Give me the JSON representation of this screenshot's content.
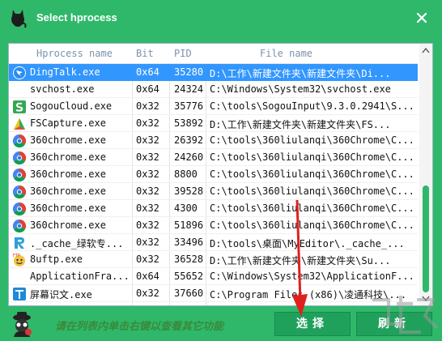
{
  "window": {
    "title": "Select hprocess",
    "app_icon": "black-cat-icon",
    "close_icon": "close-icon",
    "accent_color": "#2fb86a",
    "selection_color": "#3296ff"
  },
  "table": {
    "columns": [
      "Hprocess name",
      "Bit",
      "PID",
      "File name"
    ],
    "rows": [
      {
        "name": "DingTalk.exe",
        "bit": "0x64",
        "pid": "35280",
        "file": "D:\\工作\\新建文件夹\\新建文件夹\\Di...",
        "icon": "dingtalk-icon",
        "selected": true
      },
      {
        "name": "svchost.exe",
        "bit": "0x64",
        "pid": "24324",
        "file": "C:\\Windows\\System32\\svchost.exe",
        "icon": "blank-icon",
        "selected": false
      },
      {
        "name": "SogouCloud.exe",
        "bit": "0x32",
        "pid": "35776",
        "file": "C:\\tools\\SogouInput\\9.3.0.2941\\S...",
        "icon": "sogou-icon",
        "selected": false
      },
      {
        "name": "FSCapture.exe",
        "bit": "0x32",
        "pid": "53892",
        "file": "D:\\工作\\新建文件夹\\新建文件夹\\FS...",
        "icon": "fscapture-icon",
        "selected": false
      },
      {
        "name": "360chrome.exe",
        "bit": "0x32",
        "pid": "26392",
        "file": "C:\\tools\\360liulanqi\\360Chrome\\C...",
        "icon": "360chrome-icon",
        "selected": false
      },
      {
        "name": "360chrome.exe",
        "bit": "0x32",
        "pid": "24260",
        "file": "C:\\tools\\360liulanqi\\360Chrome\\C...",
        "icon": "360chrome-icon",
        "selected": false
      },
      {
        "name": "360chrome.exe",
        "bit": "0x32",
        "pid": "8800",
        "file": "C:\\tools\\360liulanqi\\360Chrome\\C...",
        "icon": "360chrome-icon",
        "selected": false
      },
      {
        "name": "360chrome.exe",
        "bit": "0x32",
        "pid": "39528",
        "file": "C:\\tools\\360liulanqi\\360Chrome\\C...",
        "icon": "360chrome-icon",
        "selected": false
      },
      {
        "name": "360chrome.exe",
        "bit": "0x32",
        "pid": "4300",
        "file": "C:\\tools\\360liulanqi\\360Chrome\\C...",
        "icon": "360chrome-icon",
        "selected": false
      },
      {
        "name": "360chrome.exe",
        "bit": "0x32",
        "pid": "51896",
        "file": "C:\\tools\\360liulanqi\\360Chrome\\C...",
        "icon": "360chrome-icon",
        "selected": false
      },
      {
        "name": "._cache_绿软专...",
        "bit": "0x32",
        "pid": "33496",
        "file": "D:\\tools\\桌面\\MyEditor\\._cache_...",
        "icon": "r-logo-icon",
        "selected": false
      },
      {
        "name": "8uftp.exe",
        "bit": "0x32",
        "pid": "36528",
        "file": "D:\\工作\\新建文件夹\\新建文件夹\\Su...",
        "icon": "ftp-icon",
        "selected": false
      },
      {
        "name": "ApplicationFra...",
        "bit": "0x64",
        "pid": "55652",
        "file": "C:\\Windows\\System32\\ApplicationF...",
        "icon": "blank-icon",
        "selected": false
      },
      {
        "name": "屏幕识文.exe",
        "bit": "0x32",
        "pid": "37660",
        "file": "C:\\Program Files (x86)\\凌通科技\\...",
        "icon": "t-text-icon",
        "selected": false
      }
    ]
  },
  "footer": {
    "hint": "请在列表内单击右键以查看其它功能",
    "icon": "spy-cat-icon",
    "select_label": "选择",
    "refresh_label": "刷新"
  }
}
